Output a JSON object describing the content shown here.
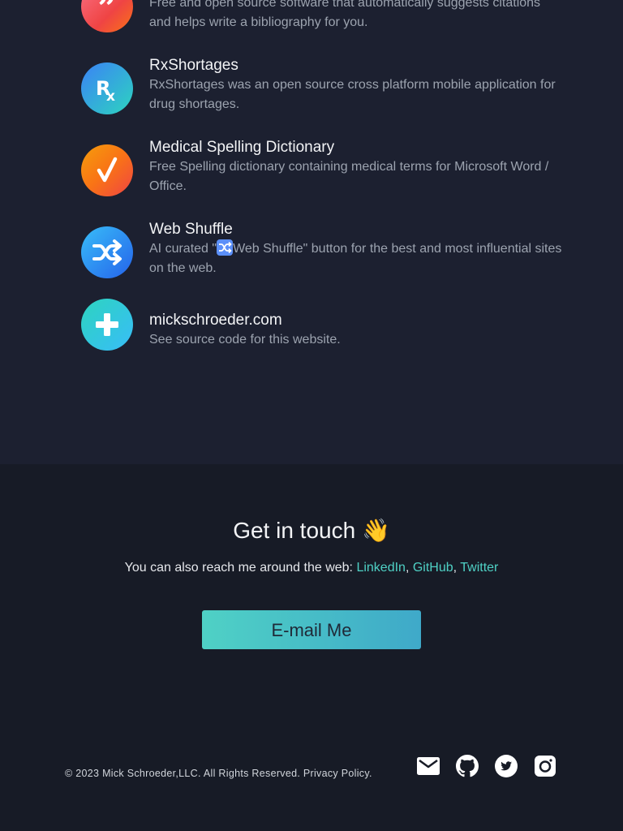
{
  "projects": [
    {
      "icon": "quote-icon",
      "title": "",
      "desc": "Free and open source software that automatically suggests citations and helps write a bibliography for you."
    },
    {
      "icon": "rx-icon",
      "title": "RxShortages",
      "desc": "RxShortages was an open source cross platform mobile application for drug shortages."
    },
    {
      "icon": "checkmark-icon",
      "title": "Medical Spelling Dictionary",
      "desc": "Free Spelling dictionary containing medical terms for Microsoft Word / Office."
    },
    {
      "icon": "shuffle-icon",
      "title": "Web Shuffle",
      "desc_prefix": "AI curated \"",
      "desc_suffix": "Web Shuffle\" button for the best and most influential sites on the web."
    },
    {
      "icon": "plus-icon",
      "title": "mickschroeder.com",
      "desc": "See source code for this website."
    }
  ],
  "contact": {
    "title": "Get in touch 👋",
    "intro": "You can also reach me around the web: ",
    "links": [
      "LinkedIn",
      "GitHub",
      "Twitter"
    ],
    "separator": ", ",
    "button": "E-mail Me"
  },
  "footer": {
    "copyright": "© 2023 Mick Schroeder,LLC. All Rights Reserved. Privacy Policy.",
    "social_icons": [
      "mail-icon",
      "github-icon",
      "twitter-icon",
      "instagram-icon"
    ]
  },
  "colors": {
    "accent": "#4fd1c5",
    "background": "#171b26",
    "section": "#1c2030"
  }
}
